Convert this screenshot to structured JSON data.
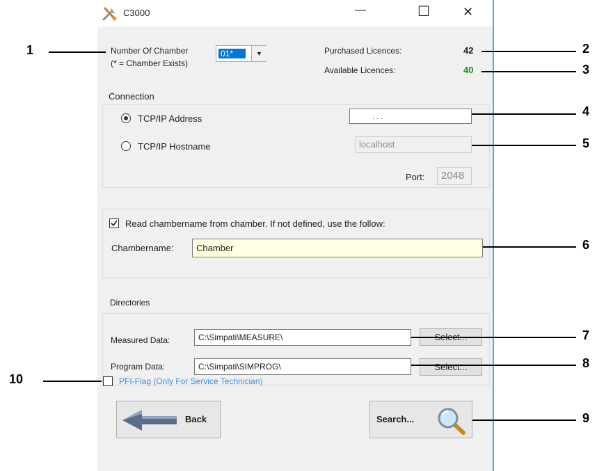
{
  "window": {
    "title": "C3000",
    "minimize_glyph": "—",
    "maximize_glyph": "☐",
    "close_glyph": "✕"
  },
  "chamber": {
    "label_line1": "Number Of Chamber",
    "label_line2": "(* = Chamber Exists)",
    "selected": "01*"
  },
  "licences": {
    "purchased_label": "Purchased Licences:",
    "purchased_value": "42",
    "available_label": "Available Licences:",
    "available_value": "40",
    "available_color": "#1e8c1e"
  },
  "connection": {
    "group_label": "Connection",
    "tcpip_address_label": "TCP/IP Address",
    "ip_value": ".          .          .",
    "tcpip_hostname_label": "TCP/IP Hostname",
    "hostname_value": "localhost",
    "port_label": "Port:",
    "port_value": "2048"
  },
  "chambername": {
    "checkbox_label": "Read chambername from chamber. If not defined, use the follow:",
    "label": "Chambername:",
    "value": "Chamber"
  },
  "directories": {
    "group_label": "Directories",
    "measured_label": "Measured Data:",
    "measured_value": "C:\\Simpati\\MEASURE\\",
    "program_label": "Program Data:",
    "program_value": "C:\\Simpati\\SIMPROG\\",
    "select_label": "Select..."
  },
  "pfi": {
    "label": "PFI-Flag (Only For Service Technician)",
    "color": "#3c8ce6"
  },
  "buttons": {
    "back": "Back",
    "search": "Search..."
  },
  "callouts": [
    "1",
    "2",
    "3",
    "4",
    "5",
    "6",
    "7",
    "8",
    "9",
    "10"
  ]
}
